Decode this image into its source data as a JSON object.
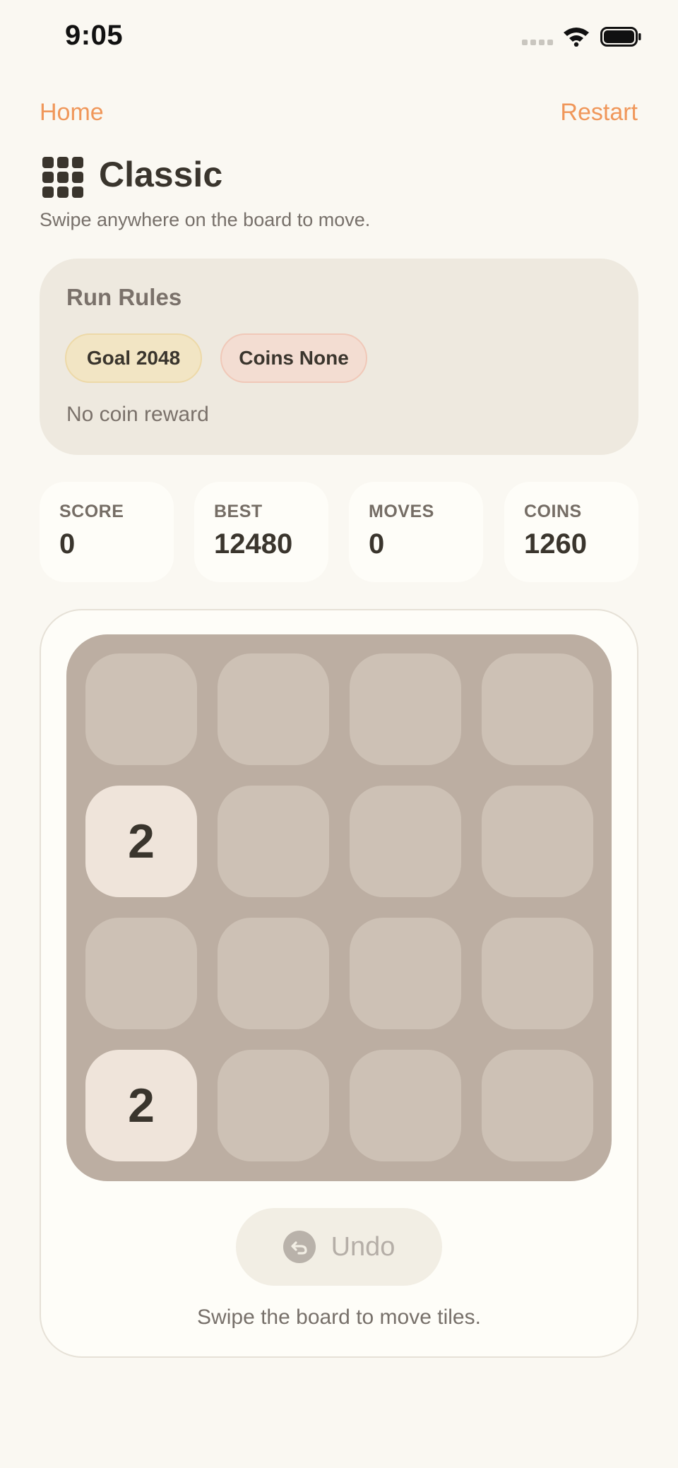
{
  "status_bar": {
    "time": "9:05"
  },
  "nav": {
    "home_label": "Home",
    "restart_label": "Restart"
  },
  "header": {
    "title": "Classic",
    "subtitle": "Swipe anywhere on the board to move."
  },
  "rules": {
    "title": "Run Rules",
    "goal_chip": "Goal 2048",
    "coins_chip": "Coins None",
    "note": "No coin reward"
  },
  "stats": [
    {
      "label": "SCORE",
      "value": "0"
    },
    {
      "label": "BEST",
      "value": "12480"
    },
    {
      "label": "MOVES",
      "value": "0"
    },
    {
      "label": "COINS",
      "value": "1260"
    }
  ],
  "board": {
    "size": 4,
    "cells": [
      [
        "",
        "",
        "",
        ""
      ],
      [
        "2",
        "",
        "",
        ""
      ],
      [
        "",
        "",
        "",
        ""
      ],
      [
        "2",
        "",
        "",
        ""
      ]
    ]
  },
  "controls": {
    "undo_label": "Undo"
  },
  "footer": {
    "hint": "Swipe the board to move tiles."
  },
  "colors": {
    "accent": "#F0975A",
    "background": "#FAF8F2",
    "board": "#BCAEA2",
    "empty_tile": "#CDC1B5",
    "tile_2": "#EFE4DA"
  }
}
